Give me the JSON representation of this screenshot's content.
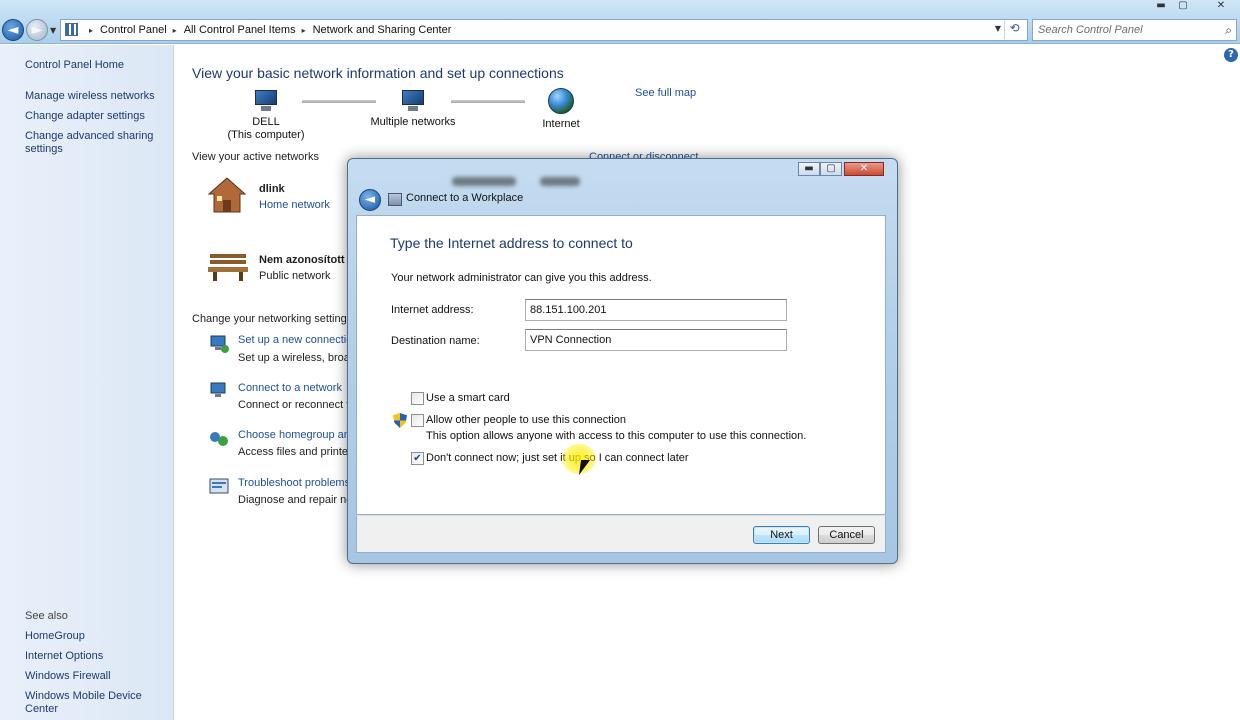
{
  "window": {
    "controls": {
      "minimize": "▬",
      "maximize": "▢",
      "close": "✕"
    }
  },
  "nav": {
    "back_glyph": "◄",
    "forward_glyph": "►",
    "breadcrumbs": [
      "Control Panel",
      "All Control Panel Items",
      "Network and Sharing Center"
    ],
    "crumb_separator": "▸",
    "dropdown_glyph": "▼",
    "refresh_glyph": "⟲",
    "search_placeholder": "Search Control Panel",
    "search_glyph": "⌕"
  },
  "sidebar": {
    "home": "Control Panel Home",
    "links": [
      "Manage wireless networks",
      "Change adapter settings",
      "Change advanced sharing settings"
    ],
    "see_also_heading": "See also",
    "see_also": [
      "HomeGroup",
      "Internet Options",
      "Windows Firewall",
      "Windows Mobile Device Center"
    ]
  },
  "main": {
    "help_glyph": "?",
    "title": "View your basic network information and set up connections",
    "map": {
      "computer_name": "DELL",
      "computer_sub": "(This computer)",
      "middle": "Multiple networks",
      "internet": "Internet",
      "see_full_map": "See full map"
    },
    "active_heading": "View your active networks",
    "connect_or_disconnect": "Connect or disconnect",
    "networks": [
      {
        "name": "dlink",
        "type": "Home network"
      },
      {
        "name": "Nem azonosított há",
        "type": "Public network"
      }
    ],
    "change_heading": "Change your networking settings",
    "tasks": [
      {
        "title": "Set up a new connection",
        "desc": "Set up a wireless, broadband"
      },
      {
        "title": "Connect to a network",
        "desc": "Connect or reconnect to"
      },
      {
        "title": "Choose homegroup and",
        "desc": "Access files and printers"
      },
      {
        "title": "Troubleshoot problems",
        "desc": "Diagnose and repair net"
      }
    ]
  },
  "dialog": {
    "caption": "Connect to a Workplace",
    "back_glyph": "◄",
    "controls": {
      "minimize": "▬",
      "maximize": "▢",
      "close": "✕"
    },
    "heading": "Type the Internet address to connect to",
    "hint": "Your network administrator can give you this address.",
    "internet_address_label": "Internet address:",
    "internet_address_value": "88.151.100.201",
    "destination_label": "Destination name:",
    "destination_value": "VPN Connection",
    "options": {
      "smart_card": {
        "label": "Use a smart card",
        "checked": false
      },
      "allow_others": {
        "label": "Allow other people to use this connection",
        "checked": false,
        "note": "This option allows anyone with access to this computer to use this connection."
      },
      "dont_connect": {
        "label": "Don't connect now; just set it up so I can connect later",
        "checked": true
      }
    },
    "check_glyph": "✔",
    "next_label": "Next",
    "cancel_label": "Cancel"
  }
}
